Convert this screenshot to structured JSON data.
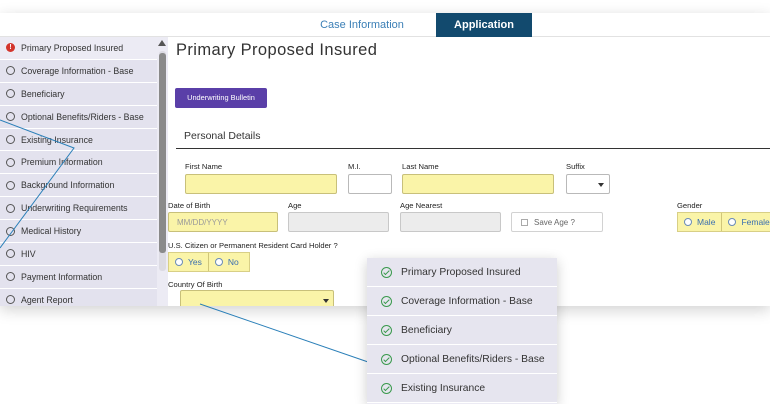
{
  "tabs": {
    "case_info": "Case Information",
    "application": "Application"
  },
  "sidebar": {
    "items": [
      {
        "label": "Primary Proposed Insured",
        "status": "warning"
      },
      {
        "label": "Coverage Information - Base",
        "status": "incomplete"
      },
      {
        "label": "Beneficiary",
        "status": "incomplete"
      },
      {
        "label": "Optional Benefits/Riders - Base",
        "status": "incomplete"
      },
      {
        "label": "Existing Insurance",
        "status": "incomplete"
      },
      {
        "label": "Premium Information",
        "status": "incomplete"
      },
      {
        "label": "Background Information",
        "status": "incomplete"
      },
      {
        "label": "Underwriting Requirements",
        "status": "incomplete"
      },
      {
        "label": "Medical History",
        "status": "incomplete"
      },
      {
        "label": "HIV",
        "status": "incomplete"
      },
      {
        "label": "Payment Information",
        "status": "incomplete"
      },
      {
        "label": "Agent Report",
        "status": "incomplete"
      }
    ]
  },
  "main": {
    "page_title": "Primary Proposed Insured",
    "bulletin_button": "Underwriting Bulletin",
    "section_title": "Personal Details",
    "labels": {
      "first_name": "First Name",
      "mi": "M.I.",
      "last_name": "Last Name",
      "suffix": "Suffix",
      "dob": "Date of Birth",
      "age": "Age",
      "age_nearest": "Age Nearest",
      "gender": "Gender",
      "citizen": "U.S. Citizen or Permanent Resident Card Holder ?",
      "country": "Country Of Birth"
    },
    "dob_placeholder": "MM/DD/YYYY",
    "save_age": "Save Age ?",
    "gender_options": [
      "Male",
      "Female"
    ],
    "citizen_options": [
      "Yes",
      "No"
    ]
  },
  "popup": {
    "items": [
      "Primary Proposed Insured",
      "Coverage Information - Base",
      "Beneficiary",
      "Optional Benefits/Riders - Base",
      "Existing Insurance"
    ]
  },
  "colors": {
    "tab_active": "#124a6e",
    "tab_link": "#3b7fb6",
    "button": "#5a3fa8",
    "required_field": "#faf4a8",
    "warning": "#d3352c",
    "complete_check": "#3a9a4d",
    "connector": "#2a7fb8"
  }
}
